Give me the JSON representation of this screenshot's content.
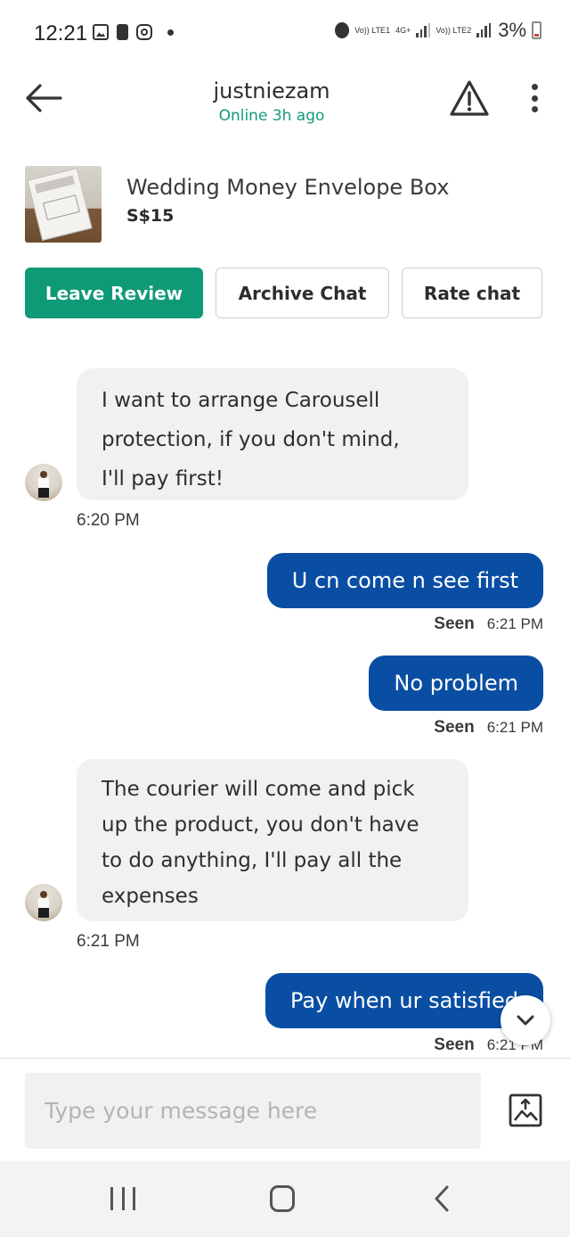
{
  "status_bar": {
    "time": "12:21",
    "sim1_label": "Vo)) LTE1",
    "net_label": "4G+",
    "sim2_label": "Vo)) LTE2",
    "battery": "3%"
  },
  "header": {
    "title": "justniezam",
    "status": "Online 3h ago",
    "icons": {
      "back": "arrow-left-icon",
      "report": "warning-triangle-icon",
      "more": "more-vertical-icon"
    }
  },
  "product": {
    "name": "Wedding Money Envelope Box",
    "price": "S$15"
  },
  "actions": {
    "leave_review": "Leave Review",
    "archive_chat": "Archive Chat",
    "rate_chat": "Rate chat"
  },
  "messages": [
    {
      "direction": "incoming",
      "lines": [
        "I want to arrange Carousell",
        "protection, if you don't mind,",
        "I'll pay first!"
      ],
      "time": "6:20 PM"
    },
    {
      "direction": "outgoing",
      "text": "U cn come n see first",
      "seen": "Seen",
      "time": "6:21 PM"
    },
    {
      "direction": "outgoing",
      "text": "No problem",
      "seen": "Seen",
      "time": "6:21 PM"
    },
    {
      "direction": "incoming",
      "lines": [
        "The courier will come and pick",
        "up the product, you don't have",
        "to do anything, I'll pay all the",
        "expenses"
      ],
      "time": "6:21 PM"
    },
    {
      "direction": "outgoing",
      "text": "Pay when ur satisfied",
      "seen": "Seen",
      "time": "6:21 PM"
    }
  ],
  "composer": {
    "placeholder": "Type your message here",
    "icons": {
      "image": "image-upload-icon",
      "scroll": "chevron-down-icon"
    }
  },
  "colors": {
    "accent_green": "#0f9a77",
    "online_green": "#139a7c",
    "outgoing_bubble": "#0a4ea3",
    "incoming_bubble": "#f0f1f1"
  }
}
